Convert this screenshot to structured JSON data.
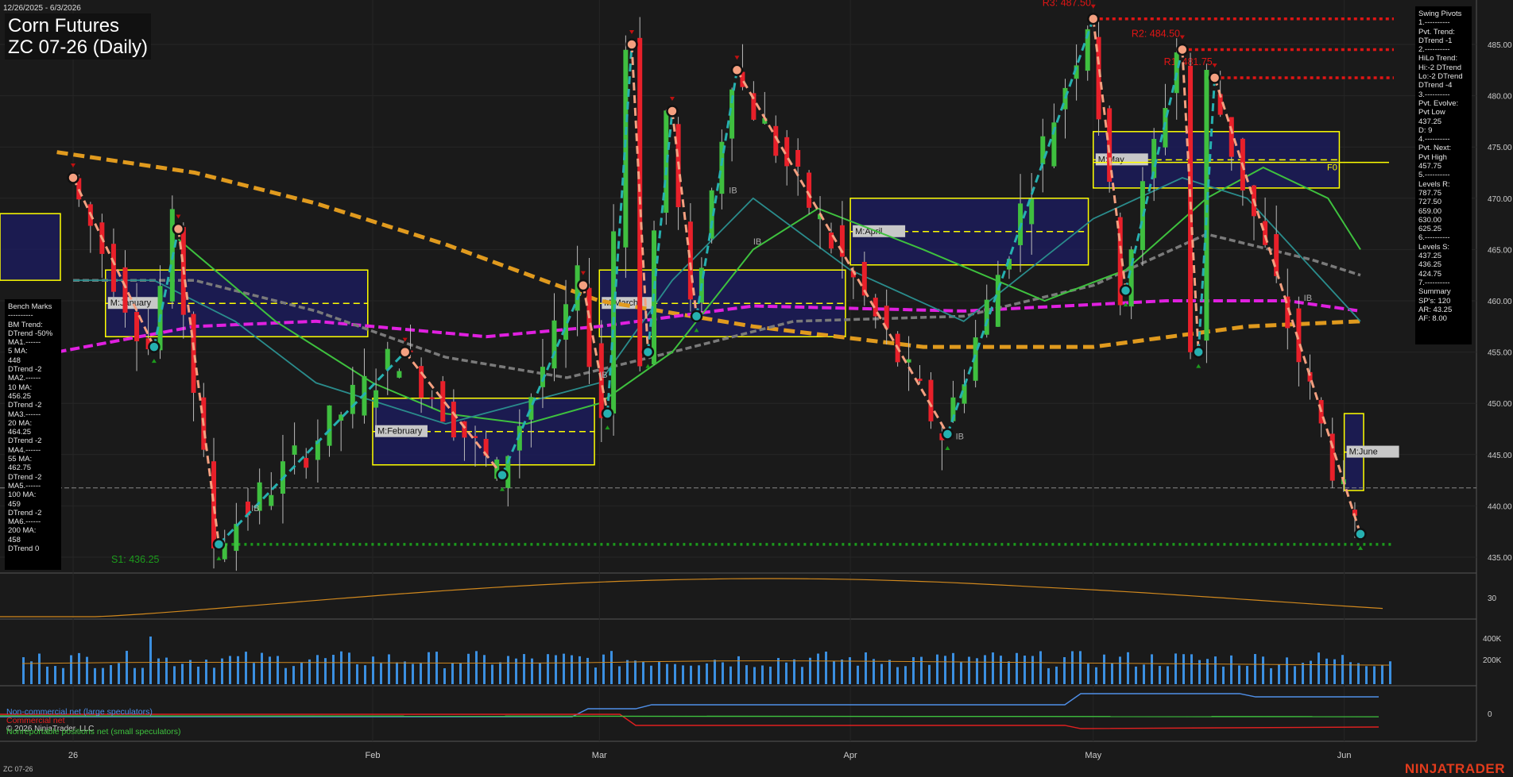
{
  "header": {
    "date_range": "12/26/2025 - 6/3/2026",
    "title": "Corn Futures",
    "subtitle": "ZC 07-26 (Daily)"
  },
  "bench_marks": {
    "lines": [
      "Bench Marks",
      "----------",
      "BM Trend:",
      "DTrend -50%",
      "MA1.------",
      "5 MA:",
      "448",
      "DTrend -2",
      "MA2.------",
      "10 MA:",
      "456.25",
      "DTrend -2",
      "MA3.------",
      "20 MA:",
      "464.25",
      "DTrend -2",
      "MA4.------",
      "55 MA:",
      "462.75",
      "DTrend -2",
      "MA5.------",
      "100 MA:",
      "459",
      "DTrend -2",
      "MA6.------",
      "200 MA:",
      "458",
      "DTrend 0"
    ]
  },
  "swing_pivots": {
    "lines": [
      "Swing Pivots",
      "1.----------",
      "Pvt. Trend:",
      "DTrend -1",
      "2.----------",
      "HiLo Trend:",
      "Hi:-2 DTrend",
      "Lo:-2 DTrend",
      "DTrend -4",
      "3.----------",
      "Pvt. Evolve:",
      "Pvt Low",
      "437.25",
      "D: 9",
      "4.----------",
      "Pvt. Next:",
      "Pvt High",
      "457.75",
      "5.----------",
      "Levels R:",
      "787.75",
      "727.50",
      "659.00",
      "630.00",
      "625.25",
      "6.----------",
      "Levels S:",
      "437.25",
      "436.25",
      "424.75",
      "7.----------",
      "Summary",
      "SP's: 120",
      "AR: 43.25",
      "AF: 8.00"
    ]
  },
  "levels": {
    "r3": "R3: 487.50",
    "r2": "R2: 484.50",
    "r1": "R1: 481.75",
    "s1": "S1: 436.25",
    "f0": "F0"
  },
  "monthly_boxes": [
    "M:January",
    "M:February",
    "M:March",
    "M:April",
    "M:May",
    "M:June"
  ],
  "ib_labels": [
    "IB",
    "IB",
    "IB",
    "IB",
    "IB",
    "IB"
  ],
  "price_axis": {
    "ticks": [
      "485.00",
      "480.00",
      "475.00",
      "470.00",
      "465.00",
      "460.00",
      "455.00",
      "450.00",
      "445.00",
      "440.00",
      "435.00"
    ],
    "values": [
      485,
      480,
      475,
      470,
      465,
      460,
      455,
      450,
      445,
      440,
      435
    ]
  },
  "indicator_axes": {
    "adx_tick": "30",
    "volume_ticks": [
      "400K",
      "200K"
    ],
    "cot_tick": "0"
  },
  "time_axis": {
    "labels": [
      "26",
      "Feb",
      "Mar",
      "Apr",
      "May",
      "Jun"
    ]
  },
  "cot_legend": {
    "noncommercial": "Non-commercial net (large speculators)",
    "commercial": "Commercial net",
    "nonreportable": "Nonreportable positions net (small speculators)"
  },
  "copyright": "© 2026 NinjaTrader, LLC",
  "footer_symbol": "ZC 07-26",
  "brand": "NINJATRADER",
  "colors": {
    "background": "#1a1a1a",
    "up_candle": "#3fbf3f",
    "down_candle": "#e8202a",
    "resistance": "#e01515",
    "support": "#1c9b1c",
    "ma_orange": "#e09a1e",
    "ma_magenta": "#e020e0",
    "ma_green": "#3ec13e",
    "ma_gray": "#7a7a7a",
    "swing_up": "#26b0b0",
    "swing_down": "#f4a080",
    "box_fill": "#1c1c5a",
    "box_border": "#ffff00"
  },
  "chart_data": {
    "type": "candlestick",
    "symbol": "ZC 07-26",
    "interval": "Daily",
    "ylim": [
      433,
      489
    ],
    "swing_points": [
      {
        "date": "2025-12-26",
        "price": 472.0,
        "type": "high"
      },
      {
        "date": "2026-01-05",
        "price": 455.5,
        "type": "low"
      },
      {
        "date": "2026-01-08",
        "price": 467.0,
        "type": "high"
      },
      {
        "date": "2026-01-13",
        "price": 436.25,
        "type": "low"
      },
      {
        "date": "2026-02-05",
        "price": 455.0,
        "type": "high"
      },
      {
        "date": "2026-02-17",
        "price": 443.0,
        "type": "low"
      },
      {
        "date": "2026-02-27",
        "price": 461.5,
        "type": "high"
      },
      {
        "date": "2026-03-02",
        "price": 449.0,
        "type": "low"
      },
      {
        "date": "2026-03-05",
        "price": 485.0,
        "type": "high"
      },
      {
        "date": "2026-03-07",
        "price": 455.0,
        "type": "low"
      },
      {
        "date": "2026-03-10",
        "price": 478.5,
        "type": "high"
      },
      {
        "date": "2026-03-13",
        "price": 458.5,
        "type": "low"
      },
      {
        "date": "2026-03-18",
        "price": 482.5,
        "type": "high"
      },
      {
        "date": "2026-04-13",
        "price": 447.0,
        "type": "low"
      },
      {
        "date": "2026-05-01",
        "price": 487.5,
        "type": "high"
      },
      {
        "date": "2026-05-05",
        "price": 461.0,
        "type": "low"
      },
      {
        "date": "2026-05-12",
        "price": 484.5,
        "type": "high"
      },
      {
        "date": "2026-05-14",
        "price": 455.0,
        "type": "low"
      },
      {
        "date": "2026-05-16",
        "price": 481.75,
        "type": "high"
      },
      {
        "date": "2026-06-03",
        "price": 437.25,
        "type": "low"
      }
    ],
    "moving_averages": [
      {
        "name": "5 MA",
        "value": 448
      },
      {
        "name": "10 MA",
        "value": 456.25
      },
      {
        "name": "20 MA",
        "value": 464.25
      },
      {
        "name": "55 MA",
        "value": 462.75
      },
      {
        "name": "100 MA",
        "value": 459
      },
      {
        "name": "200 MA",
        "value": 458
      }
    ],
    "resistance": [
      487.5,
      484.5,
      481.75
    ],
    "support": [
      436.25
    ],
    "monthly_ranges": [
      {
        "name": "M:January",
        "high": 463.0,
        "low": 456.5
      },
      {
        "name": "M:February",
        "high": 450.5,
        "low": 444.0
      },
      {
        "name": "M:March",
        "high": 463.0,
        "low": 456.5
      },
      {
        "name": "M:April",
        "high": 470.0,
        "low": 463.5
      },
      {
        "name": "M:May",
        "high": 476.5,
        "low": 471.0
      },
      {
        "name": "M:June",
        "high": 449.0,
        "low": 441.5
      }
    ]
  }
}
